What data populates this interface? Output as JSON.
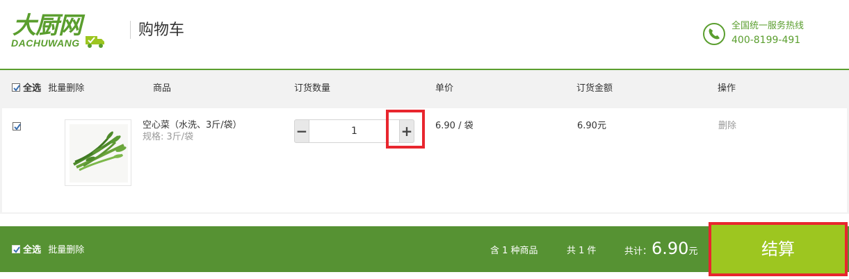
{
  "header": {
    "logo_cn": "大厨网",
    "logo_en": "DACHUWANG",
    "page_title": "购物车",
    "hotline_label": "全国统一服务热线",
    "hotline_number": "400-8199-491"
  },
  "table_header": {
    "select_all": "全选",
    "batch_delete": "批量删除",
    "col_product": "商品",
    "col_quantity": "订货数量",
    "col_unit_price": "单价",
    "col_amount": "订货金额",
    "col_action": "操作"
  },
  "items": [
    {
      "checked": true,
      "name": "空心菜（水洗、3斤/袋）",
      "spec": "规格: 3斤/袋",
      "quantity": "1",
      "minus_label": "−",
      "plus_label": "+",
      "unit_price": "6.90 / 袋",
      "amount": "6.90元",
      "delete_label": "删除"
    }
  ],
  "footer": {
    "select_all": "全选",
    "batch_delete": "批量删除",
    "kind_count": "含 1 种商品",
    "item_count": "共 1 件",
    "total_label": "共计：",
    "total_value": "6.90",
    "total_unit": "元",
    "checkout_label": "结算"
  },
  "colors": {
    "brand_green": "#569233",
    "checkout_green": "#9dc620",
    "highlight_red": "#e8262e"
  }
}
